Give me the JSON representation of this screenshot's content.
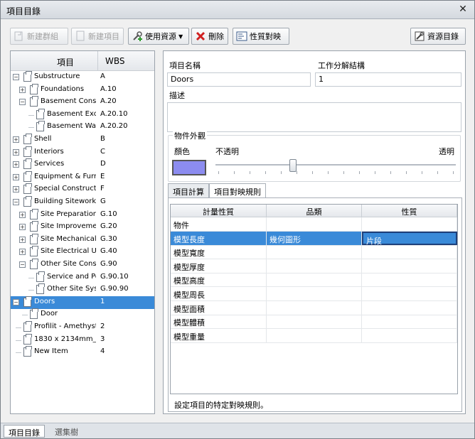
{
  "window": {
    "title": "項目目錄",
    "close_glyph": "✕"
  },
  "toolbar": {
    "new_group": "新建群組",
    "new_item": "新建項目",
    "use_resource": "使用資源",
    "delete": "刪除",
    "property_mapping": "性質對映",
    "resource_catalog": "資源目錄"
  },
  "tree": {
    "header_item": "項目",
    "header_wbs": "WBS",
    "rows": [
      {
        "name": "Substructure",
        "wbs": "A"
      },
      {
        "name": "Foundations",
        "wbs": "A.10"
      },
      {
        "name": "Basement Constr...",
        "wbs": "A.20"
      },
      {
        "name": "Basement Exca...",
        "wbs": "A.20.10"
      },
      {
        "name": "Basement Walls",
        "wbs": "A.20.20"
      },
      {
        "name": "Shell",
        "wbs": "B"
      },
      {
        "name": "Interiors",
        "wbs": "C"
      },
      {
        "name": "Services",
        "wbs": "D"
      },
      {
        "name": "Equipment & Furni...",
        "wbs": "E"
      },
      {
        "name": "Special Constructio...",
        "wbs": "F"
      },
      {
        "name": "Building Sitework",
        "wbs": "G"
      },
      {
        "name": "Site Preparation",
        "wbs": "G.10"
      },
      {
        "name": "Site Improvements",
        "wbs": "G.20"
      },
      {
        "name": "Site Mechanical...",
        "wbs": "G.30"
      },
      {
        "name": "Site Electrical Uti...",
        "wbs": "G.40"
      },
      {
        "name": "Other Site Const...",
        "wbs": "G.90"
      },
      {
        "name": "Service and Pe...",
        "wbs": "G.90.10"
      },
      {
        "name": "Other Site Syst...",
        "wbs": "G.90.90"
      },
      {
        "name": "Doors",
        "wbs": "1"
      },
      {
        "name": "Door",
        "wbs": ""
      },
      {
        "name": "Profilit - Amethyst",
        "wbs": "2"
      },
      {
        "name": "1830 x 2134mm_M...",
        "wbs": "3"
      },
      {
        "name": "New Item",
        "wbs": "4"
      }
    ]
  },
  "details": {
    "item_name_label": "項目名稱",
    "item_name_value": "Doors",
    "wbs_label": "工作分解結構",
    "wbs_value": "1",
    "description_label": "描述",
    "appearance_group": "物件外觀",
    "color_label": "顏色",
    "opaque_label": "不透明",
    "transparent_label": "透明",
    "color_value": "#8c8cf0",
    "transparency": 0.33
  },
  "tabs": {
    "item_calc": "項目計算",
    "mapping_rules": "項目對映規則"
  },
  "mapping_grid": {
    "headers": [
      "計量性質",
      "品類",
      "性質"
    ],
    "rows": [
      [
        "物件",
        "",
        ""
      ],
      [
        "模型長度",
        "幾何圖形",
        "片段"
      ],
      [
        "模型寬度",
        "",
        ""
      ],
      [
        "模型厚度",
        "",
        ""
      ],
      [
        "模型高度",
        "",
        ""
      ],
      [
        "模型周長",
        "",
        ""
      ],
      [
        "模型面積",
        "",
        ""
      ],
      [
        "模型體積",
        "",
        ""
      ],
      [
        "模型重量",
        "",
        ""
      ]
    ],
    "hint": "設定項目的特定對映規則。"
  },
  "bottom_tabs": {
    "catalog": "項目目錄",
    "selection_tree": "選集樹"
  }
}
